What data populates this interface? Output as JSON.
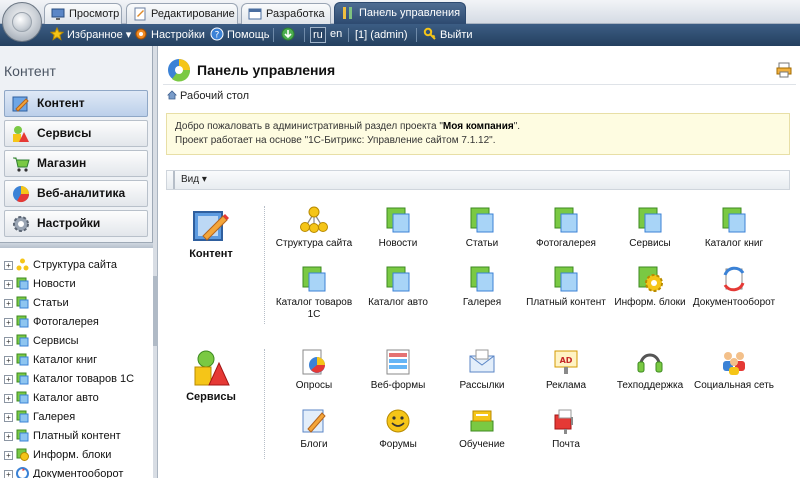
{
  "tabs": [
    {
      "label": "Просмотр",
      "active": false
    },
    {
      "label": "Редактирование",
      "active": false
    },
    {
      "label": "Разработка",
      "active": false
    },
    {
      "label": "Панель управления",
      "active": true
    }
  ],
  "toolbar": {
    "favorites": "Избранное",
    "settings": "Настройки",
    "help": "Помощь",
    "lang_ru": "ru",
    "lang_en": "en",
    "user": "[1] (admin)",
    "logout": "Выйти"
  },
  "left": {
    "title": "Контент",
    "menu": [
      {
        "label": "Контент",
        "icon": "pencil-icon",
        "active": true
      },
      {
        "label": "Сервисы",
        "icon": "shapes-icon",
        "active": false
      },
      {
        "label": "Магазин",
        "icon": "cart-icon",
        "active": false
      },
      {
        "label": "Веб-аналитика",
        "icon": "pie-chart-icon",
        "active": false
      },
      {
        "label": "Настройки",
        "icon": "gear-icon",
        "active": false
      }
    ],
    "tree": [
      {
        "label": "Структура сайта",
        "icon": "structure-icon"
      },
      {
        "label": "Новости",
        "icon": "iblock-icon"
      },
      {
        "label": "Статьи",
        "icon": "iblock-icon"
      },
      {
        "label": "Фотогалерея",
        "icon": "iblock-icon"
      },
      {
        "label": "Сервисы",
        "icon": "iblock-icon"
      },
      {
        "label": "Каталог книг",
        "icon": "iblock-icon"
      },
      {
        "label": "Каталог товаров 1С",
        "icon": "iblock-icon"
      },
      {
        "label": "Каталог авто",
        "icon": "iblock-icon"
      },
      {
        "label": "Галерея",
        "icon": "iblock-icon"
      },
      {
        "label": "Платный контент",
        "icon": "iblock-icon"
      },
      {
        "label": "Информ. блоки",
        "icon": "gear-folder-icon"
      },
      {
        "label": "Документооборот",
        "icon": "workflow-icon"
      }
    ]
  },
  "main": {
    "title": "Панель управления",
    "breadcrumb": "Рабочий стол",
    "notice_line1_pre": "Добро пожаловать в административный раздел проекта \"",
    "notice_company": "Моя компания",
    "notice_line1_post": "\".",
    "notice_line2": "Проект работает на основе \"1С-Битрикс: Управление сайтом 7.1.12\".",
    "view_label": "Вид",
    "sections": [
      {
        "label": "Контент",
        "icon": "pencil-icon",
        "items": [
          {
            "label": "Структура сайта",
            "icon": "structure-icon"
          },
          {
            "label": "Новости",
            "icon": "iblock-icon"
          },
          {
            "label": "Статьи",
            "icon": "iblock-icon"
          },
          {
            "label": "Фотогалерея",
            "icon": "iblock-icon"
          },
          {
            "label": "Сервисы",
            "icon": "iblock-icon"
          },
          {
            "label": "Каталог книг",
            "icon": "iblock-icon"
          },
          {
            "label": "Каталог товаров 1С",
            "icon": "iblock-icon"
          },
          {
            "label": "Каталог авто",
            "icon": "iblock-icon"
          },
          {
            "label": "Галерея",
            "icon": "iblock-icon"
          },
          {
            "label": "Платный контент",
            "icon": "iblock-icon"
          },
          {
            "label": "Информ. блоки",
            "icon": "gear-folder-icon"
          },
          {
            "label": "Документооборот",
            "icon": "workflow-icon"
          }
        ]
      },
      {
        "label": "Сервисы",
        "icon": "shapes-icon",
        "items": [
          {
            "label": "Опросы",
            "icon": "vote-icon"
          },
          {
            "label": "Веб-формы",
            "icon": "form-icon"
          },
          {
            "label": "Рассылки",
            "icon": "mail-icon"
          },
          {
            "label": "Реклама",
            "icon": "ad-icon"
          },
          {
            "label": "Техподдержка",
            "icon": "headset-icon"
          },
          {
            "label": "Социальная сеть",
            "icon": "people-icon"
          },
          {
            "label": "Блоги",
            "icon": "blog-icon"
          },
          {
            "label": "Форумы",
            "icon": "smiley-icon"
          },
          {
            "label": "Обучение",
            "icon": "learning-icon"
          },
          {
            "label": "Почта",
            "icon": "mailbox-icon"
          }
        ]
      }
    ]
  }
}
